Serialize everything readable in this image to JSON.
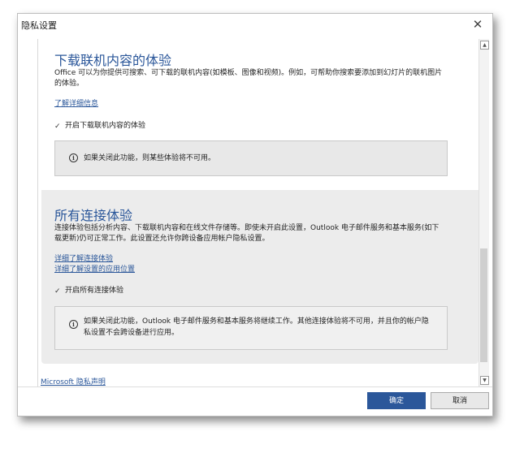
{
  "window": {
    "title": "隐私设置",
    "close_glyph": "✕"
  },
  "section_download": {
    "heading": "下载联机内容的体验",
    "description": "Office 可以为你提供可搜索、可下载的联机内容(如模板、图像和视频)。例如，可帮助你搜索要添加到幻灯片的联机图片的体验。",
    "learn_more": "了解详细信息",
    "checkbox_label": "开启下载联机内容的体验",
    "checkbox_checked": true,
    "info": "如果关闭此功能，则某些体验将不可用。"
  },
  "section_connected": {
    "heading": "所有连接体验",
    "description": "连接体验包括分析内容、下载联机内容和在线文件存储等。即使未开启此设置，Outlook 电子邮件服务和基本服务(如下载更新)仍可正常工作。此设置还允许你跨设备应用帐户隐私设置。",
    "link1": "详细了解连接体验",
    "link2": "详细了解设置的应用位置",
    "checkbox_label": "开启所有连接体验",
    "checkbox_checked": true,
    "info_line1": "如果关闭此功能，Outlook 电子邮件服务和基本服务将继续工作。其他连接体验将不可用，并且你的帐户隐",
    "info_line2": "私设置不会跨设备进行应用。"
  },
  "footer": {
    "privacy_link": "Microsoft 隐私声明",
    "ok_label": "确定",
    "cancel_label": "取消"
  },
  "icons": {
    "checkmark": "✓",
    "info": "i",
    "scroll_up": "▲",
    "scroll_down": "▼"
  },
  "colors": {
    "accent": "#2b579a",
    "panel_gray": "#ececec"
  }
}
